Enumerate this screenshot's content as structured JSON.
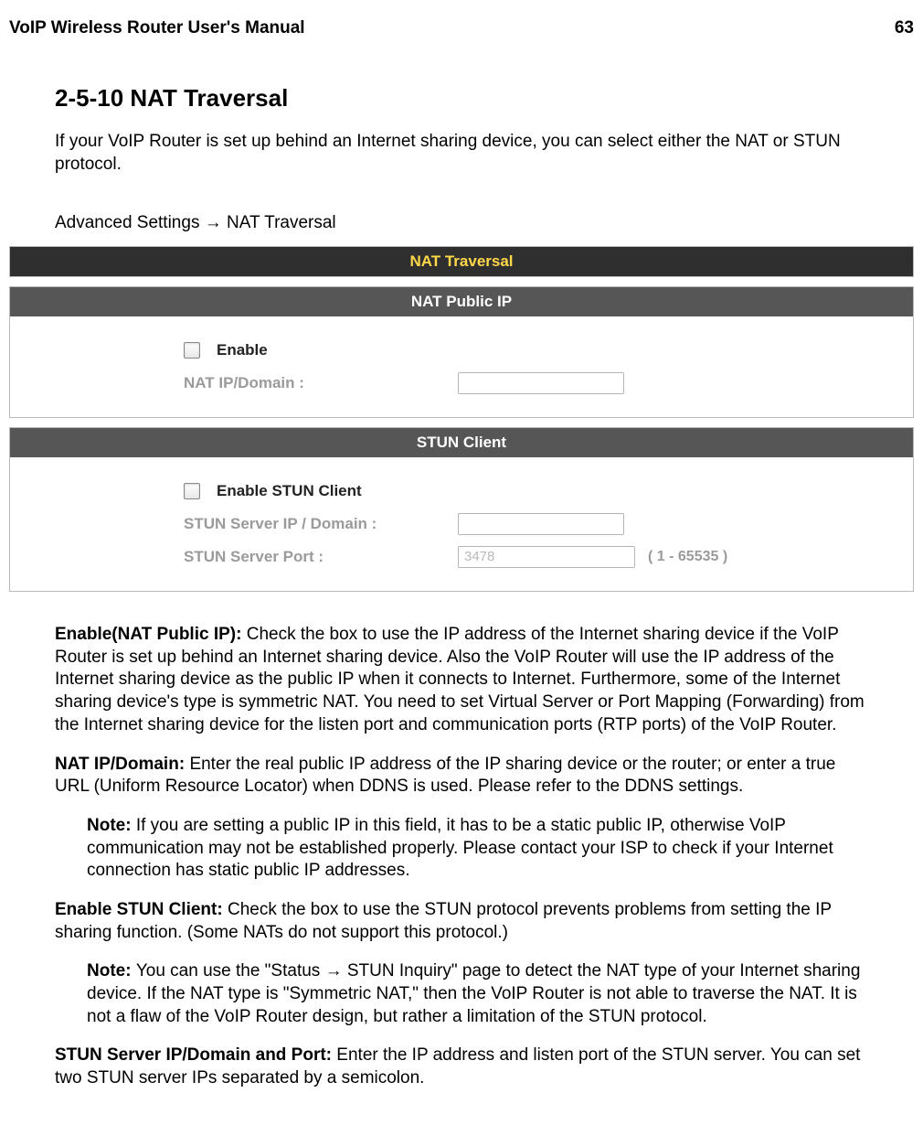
{
  "header": {
    "title": "VoIP Wireless Router User's Manual",
    "page": "63"
  },
  "h1": "2-5-10 NAT Traversal",
  "intro": "If your VoIP Router is set up behind an Internet sharing device, you can select either the NAT or STUN protocol.",
  "breadcrumb_a": "Advanced Settings ",
  "breadcrumb_b": " NAT Traversal",
  "panels": {
    "main_title": "NAT Traversal",
    "nat": {
      "title": "NAT Public IP",
      "enable": "Enable",
      "field1": "NAT IP/Domain :"
    },
    "stun": {
      "title": "STUN Client",
      "enable": "Enable STUN Client",
      "field1": "STUN Server IP / Domain :",
      "field2": "STUN Server Port :",
      "port_value": "3478",
      "port_range": "( 1 - 65535 )"
    }
  },
  "paras": {
    "p1b": "Enable(NAT Public IP): ",
    "p1": "Check the box to use the IP address of the Internet sharing device if the VoIP Router is set up behind an Internet sharing device. Also the VoIP Router will use the IP address of the Internet sharing device as the public IP when it connects to Internet. Furthermore, some of the Internet sharing device's type is symmetric NAT. You need to set Virtual Server or Port Mapping (Forwarding) from the Internet sharing device for the listen port and communication ports (RTP ports) of the VoIP Router.",
    "p2b": "NAT IP/Domain: ",
    "p2": "Enter the real public IP address of the IP sharing device or the router; or enter a true URL (Uniform Resource Locator) when DDNS is used. Please refer to the DDNS settings.",
    "n1b": "Note: ",
    "n1": "If you are setting a public IP in this field, it has to be a static public IP, otherwise VoIP communication may not be established properly. Please contact your ISP to check if your Internet connection has static public IP addresses.",
    "p3b": "Enable STUN Client: ",
    "p3": "Check the box to use the STUN protocol prevents problems from setting the IP sharing function. (Some NATs do not support this protocol.)",
    "n2b": "Note: ",
    "n2a": "You can use the \"Status ",
    "n2c": " STUN Inquiry\" page to detect the NAT type of your Internet sharing device. If the NAT type is \"Symmetric NAT,\" then the VoIP Router is not able to traverse the NAT. It is not a flaw of the VoIP Router design, but rather a limitation of the STUN protocol.",
    "p4b": "STUN Server IP/Domain and Port: ",
    "p4": "Enter the IP address and listen port of the STUN server. You can set two STUN server IPs separated by a semicolon."
  }
}
